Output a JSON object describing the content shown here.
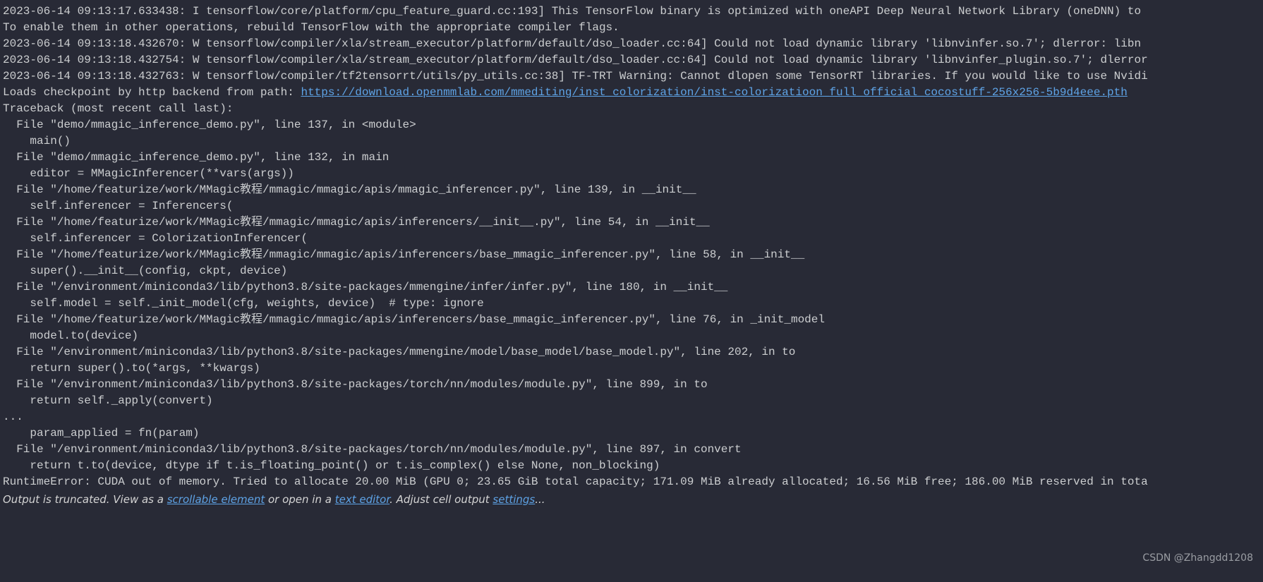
{
  "log": {
    "l0": "2023-06-14 09:13:17.633438: I tensorflow/core/platform/cpu_feature_guard.cc:193] This TensorFlow binary is optimized with oneAPI Deep Neural Network Library (oneDNN) to",
    "l1": "To enable them in other operations, rebuild TensorFlow with the appropriate compiler flags.",
    "l2": "2023-06-14 09:13:18.432670: W tensorflow/compiler/xla/stream_executor/platform/default/dso_loader.cc:64] Could not load dynamic library 'libnvinfer.so.7'; dlerror: libn",
    "l3": "2023-06-14 09:13:18.432754: W tensorflow/compiler/xla/stream_executor/platform/default/dso_loader.cc:64] Could not load dynamic library 'libnvinfer_plugin.so.7'; dlerror",
    "l4": "2023-06-14 09:13:18.432763: W tensorflow/compiler/tf2tensorrt/utils/py_utils.cc:38] TF-TRT Warning: Cannot dlopen some TensorRT libraries. If you would like to use Nvidi",
    "l5_pre": "Loads checkpoint by http backend from path: ",
    "l5_url": "https://download.openmmlab.com/mmediting/inst_colorization/inst-colorizatioon_full_official_cocostuff-256x256-5b9d4eee.pth",
    "l6": "Traceback (most recent call last):",
    "l7": "  File \"demo/mmagic_inference_demo.py\", line 137, in <module>",
    "l8": "    main()",
    "l9": "  File \"demo/mmagic_inference_demo.py\", line 132, in main",
    "l10": "    editor = MMagicInferencer(**vars(args))",
    "l11": "  File \"/home/featurize/work/MMagic教程/mmagic/mmagic/apis/mmagic_inferencer.py\", line 139, in __init__",
    "l12": "    self.inferencer = Inferencers(",
    "l13": "  File \"/home/featurize/work/MMagic教程/mmagic/mmagic/apis/inferencers/__init__.py\", line 54, in __init__",
    "l14": "    self.inferencer = ColorizationInferencer(",
    "l15": "  File \"/home/featurize/work/MMagic教程/mmagic/mmagic/apis/inferencers/base_mmagic_inferencer.py\", line 58, in __init__",
    "l16": "    super().__init__(config, ckpt, device)",
    "l17": "  File \"/environment/miniconda3/lib/python3.8/site-packages/mmengine/infer/infer.py\", line 180, in __init__",
    "l18": "    self.model = self._init_model(cfg, weights, device)  # type: ignore",
    "l19": "  File \"/home/featurize/work/MMagic教程/mmagic/mmagic/apis/inferencers/base_mmagic_inferencer.py\", line 76, in _init_model",
    "l20": "    model.to(device)",
    "l21": "  File \"/environment/miniconda3/lib/python3.8/site-packages/mmengine/model/base_model/base_model.py\", line 202, in to",
    "l22": "    return super().to(*args, **kwargs)",
    "l23": "  File \"/environment/miniconda3/lib/python3.8/site-packages/torch/nn/modules/module.py\", line 899, in to",
    "l24": "    return self._apply(convert)",
    "l25": "...",
    "l26": "    param_applied = fn(param)",
    "l27": "  File \"/environment/miniconda3/lib/python3.8/site-packages/torch/nn/modules/module.py\", line 897, in convert",
    "l28": "    return t.to(device, dtype if t.is_floating_point() or t.is_complex() else None, non_blocking)",
    "l29": "RuntimeError: CUDA out of memory. Tried to allocate 20.00 MiB (GPU 0; 23.65 GiB total capacity; 171.09 MiB already allocated; 16.56 MiB free; 186.00 MiB reserved in tota"
  },
  "truncation": {
    "p1": "Output is truncated. View as a ",
    "a1": "scrollable element",
    "p2": " or open in a ",
    "a2": "text editor",
    "p3": ". Adjust cell output ",
    "a3": "settings",
    "p4": "..."
  },
  "watermark": "CSDN @Zhangdd1208"
}
